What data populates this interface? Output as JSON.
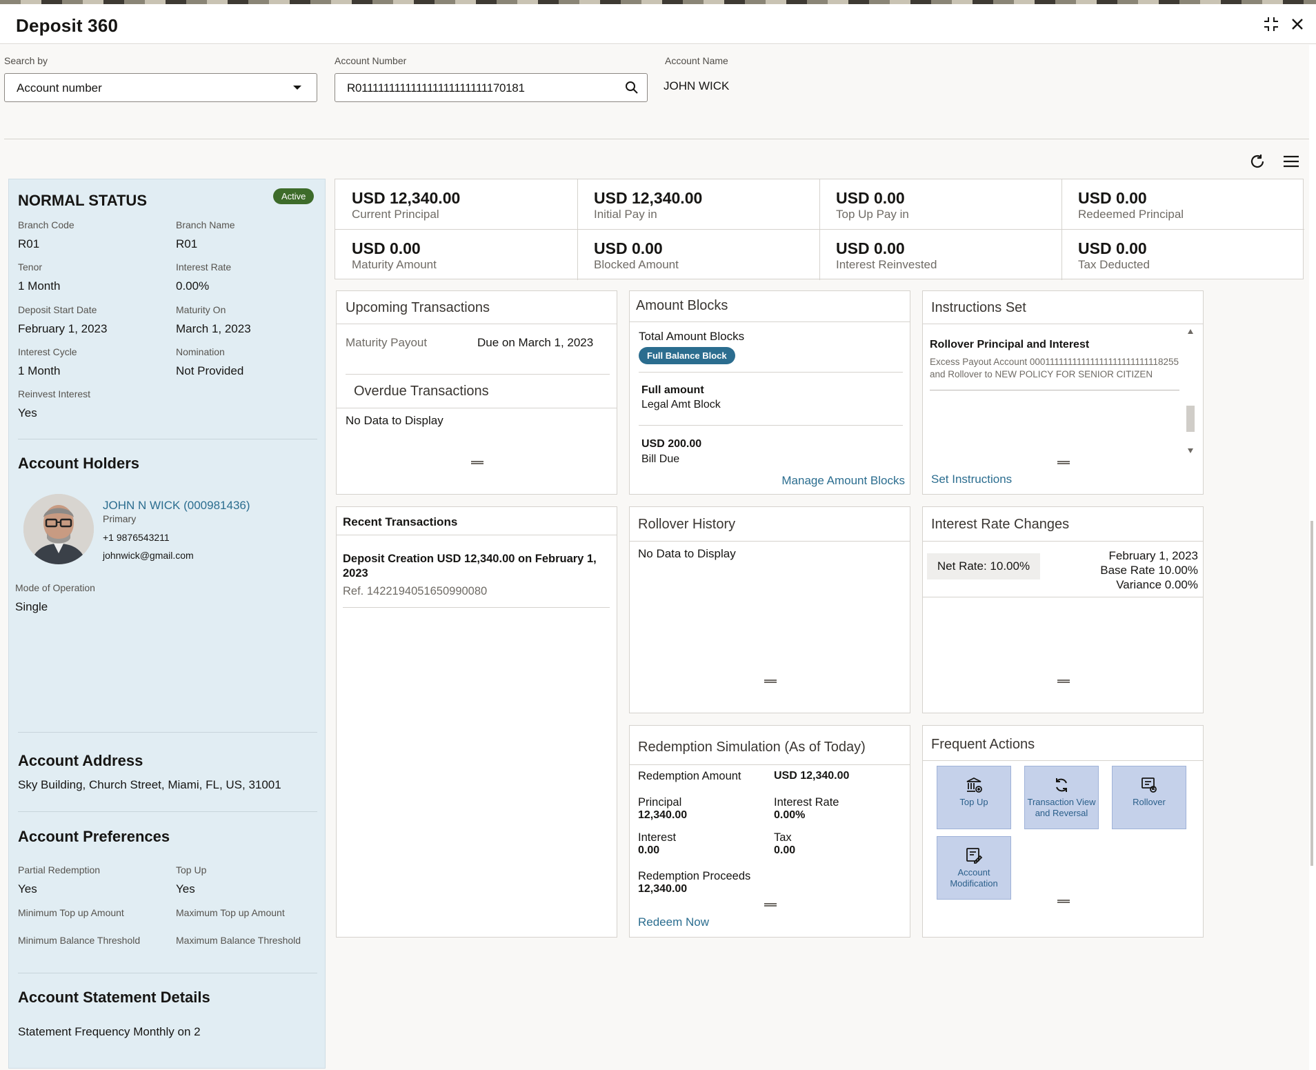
{
  "app": {
    "title": "Deposit 360"
  },
  "search": {
    "by_label": "Search by",
    "by_value": "Account number",
    "acct_label": "Account Number",
    "acct_value": "R011111111111111111111111170181",
    "name_label": "Account Name",
    "name_value": "JOHN WICK"
  },
  "status": {
    "title": "NORMAL STATUS",
    "badge": "Active",
    "fields": [
      {
        "k": "Branch Code",
        "v": "R01"
      },
      {
        "k": "Branch Name",
        "v": "R01"
      },
      {
        "k": "Tenor",
        "v": "1 Month"
      },
      {
        "k": "Interest Rate",
        "v": "0.00%"
      },
      {
        "k": "Deposit Start Date",
        "v": "February 1, 2023"
      },
      {
        "k": "Maturity On",
        "v": "March 1, 2023"
      },
      {
        "k": "Interest Cycle",
        "v": "1 Month"
      },
      {
        "k": "Nomination",
        "v": "Not Provided"
      },
      {
        "k": "Reinvest Interest",
        "v": "Yes"
      }
    ]
  },
  "holders": {
    "title": "Account Holders",
    "name": "JOHN N WICK (000981436)",
    "role": "Primary",
    "phone": "+1 9876543211",
    "email": "johnwick@gmail.com",
    "mode_label": "Mode of Operation",
    "mode_value": "Single"
  },
  "address": {
    "title": "Account Address",
    "value": "Sky Building, Church Street, Miami, FL, US, 31001"
  },
  "prefs": {
    "title": "Account Preferences",
    "partial_label": "Partial Redemption",
    "partial_value": "Yes",
    "topup_label": "Top Up",
    "topup_value": "Yes",
    "min_topup": "Minimum Top up Amount",
    "max_topup": "Maximum Top up Amount",
    "min_bal": "Minimum Balance Threshold",
    "max_bal": "Maximum Balance Threshold"
  },
  "statement": {
    "title": "Account Statement Details",
    "value": "Statement Frequency Monthly on 2"
  },
  "summary": [
    {
      "amount": "USD 12,340.00",
      "label": "Current Principal"
    },
    {
      "amount": "USD 12,340.00",
      "label": "Initial Pay in"
    },
    {
      "amount": "USD 0.00",
      "label": "Top Up Pay in"
    },
    {
      "amount": "USD 0.00",
      "label": "Redeemed Principal"
    },
    {
      "amount": "USD 0.00",
      "label": "Maturity Amount"
    },
    {
      "amount": "USD 0.00",
      "label": "Blocked Amount"
    },
    {
      "amount": "USD 0.00",
      "label": "Interest Reinvested"
    },
    {
      "amount": "USD 0.00",
      "label": "Tax Deducted"
    }
  ],
  "upcoming": {
    "title": "Upcoming Transactions",
    "k": "Maturity Payout",
    "v": "Due on March 1, 2023",
    "overdue_title": "Overdue Transactions",
    "overdue_value": "No Data to Display"
  },
  "blocks": {
    "title": "Amount Blocks",
    "total": "Total Amount Blocks",
    "chip": "Full Balance Block",
    "b1_amt": "Full amount",
    "b1_desc": "Legal Amt Block",
    "b2_amt": "USD 200.00",
    "b2_desc": "Bill Due",
    "link": "Manage Amount Blocks"
  },
  "instructions": {
    "title": "Instructions Set",
    "item_title": "Rollover Principal and Interest",
    "item_desc": "Excess Payout Account 00011111111111111111111111118255 and Rollover to NEW POLICY FOR SENIOR CITIZEN",
    "link": "Set Instructions"
  },
  "recent": {
    "title": "Recent Transactions",
    "item": "Deposit Creation USD 12,340.00 on February 1, 2023",
    "ref": "Ref. 1422194051650990080"
  },
  "rollover": {
    "title": "Rollover History",
    "empty": "No Data to Display"
  },
  "rates": {
    "title": "Interest Rate Changes",
    "net": "Net Rate: 10.00%",
    "date": "February 1, 2023",
    "base": "Base Rate 10.00%",
    "variance": "Variance 0.00%"
  },
  "redemption": {
    "title": "Redemption Simulation (As of Today)",
    "amt_label": "Redemption Amount",
    "amt_value": "USD 12,340.00",
    "principal_label": "Principal",
    "principal_value": "12,340.00",
    "rate_label": "Interest Rate",
    "rate_value": "0.00%",
    "interest_label": "Interest",
    "interest_value": "0.00",
    "tax_label": "Tax",
    "tax_value": "0.00",
    "proceeds_label": "Redemption Proceeds",
    "proceeds_value": "12,340.00",
    "link": "Redeem Now"
  },
  "frequent": {
    "title": "Frequent Actions",
    "a1": "Top Up",
    "a2": "Transaction View and Reversal",
    "a3": "Rollover",
    "a4": "Account Modification"
  },
  "colors": {
    "accent": "#2b6d8f",
    "badge": "#3d6b2a",
    "panel": "#e1edf3",
    "tile": "#c5d1ea"
  }
}
